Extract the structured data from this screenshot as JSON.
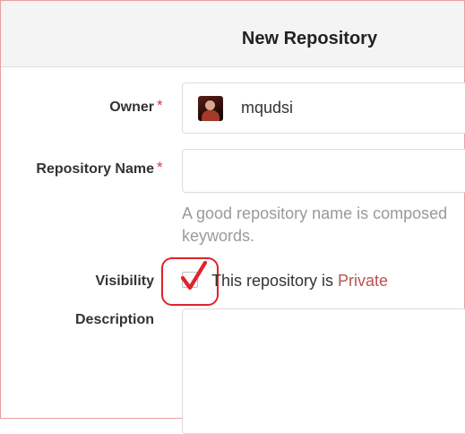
{
  "header": {
    "title": "New Repository"
  },
  "form": {
    "owner": {
      "label": "Owner",
      "required_mark": "*",
      "value": "mqudsi"
    },
    "repo_name": {
      "label": "Repository Name",
      "required_mark": "*",
      "value": "",
      "help_line1": "A good repository name is composed",
      "help_line2": "keywords."
    },
    "visibility": {
      "label": "Visibility",
      "checked": true,
      "text_prefix": "This repository is ",
      "text_private": "Private"
    },
    "description": {
      "label": "Description",
      "value": ""
    }
  },
  "colors": {
    "required": "#d23b3b",
    "private_text": "#b9534d",
    "annotation_red": "#e0222a",
    "header_bg": "#f4f4f4"
  }
}
